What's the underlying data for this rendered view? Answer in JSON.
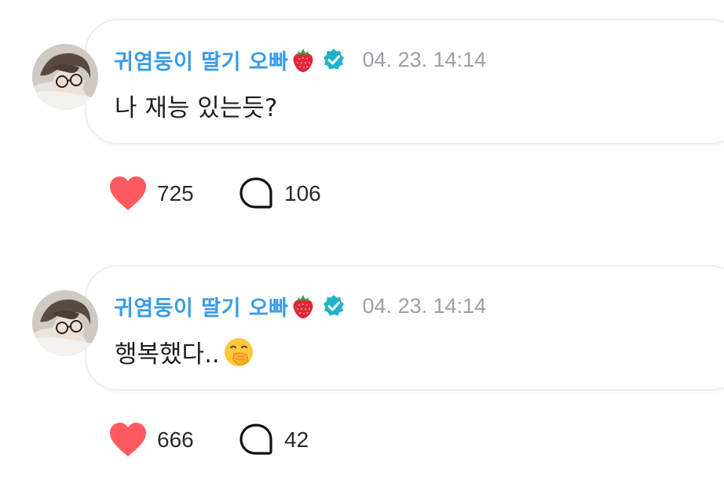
{
  "posts": [
    {
      "author": "귀염둥이 딸기 오빠",
      "author_emoji": "strawberry-icon",
      "verified": true,
      "timestamp": "04. 23. 14:14",
      "message": "나 재능 있는듯?",
      "likes": "725",
      "comments": "106"
    },
    {
      "author": "귀염둥이 딸기 오빠",
      "author_emoji": "strawberry-icon",
      "verified": true,
      "timestamp": "04. 23. 14:14",
      "message": "행복했다..",
      "message_emoji": "face-with-hand-over-mouth-icon",
      "likes": "666",
      "comments": "42"
    }
  ],
  "colors": {
    "username": "#3a9be6",
    "verified_badge": "#1fb3c9",
    "heart": "#ff5a5f",
    "timestamp": "#9aa0a6"
  }
}
